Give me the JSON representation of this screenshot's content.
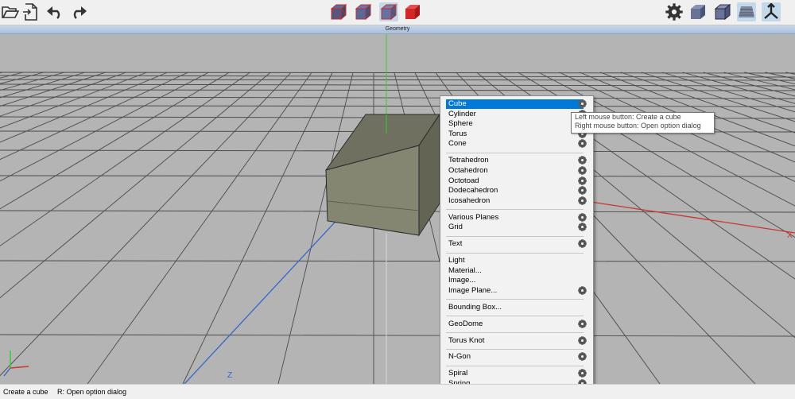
{
  "toolbar": {
    "left": [
      {
        "name": "open-folder-button",
        "icon": "folder-open-icon"
      },
      {
        "name": "import-button",
        "icon": "import-file-icon"
      },
      {
        "name": "undo-button",
        "icon": "undo-icon"
      },
      {
        "name": "redo-button",
        "icon": "redo-icon"
      }
    ],
    "center": [
      {
        "name": "wireframe-cube-button",
        "icon": "cube-wireframe-icon",
        "active": false
      },
      {
        "name": "shaded-wire-cube-button",
        "icon": "cube-shaded-wire-icon",
        "active": false
      },
      {
        "name": "flat-cube-button",
        "icon": "cube-flat-icon",
        "active": true
      },
      {
        "name": "red-cube-button",
        "icon": "cube-red-icon",
        "active": false
      }
    ],
    "right": [
      {
        "name": "settings-button",
        "icon": "gear-icon",
        "active": false
      },
      {
        "name": "solid-cube-view-button",
        "icon": "cube-solid-icon",
        "active": false
      },
      {
        "name": "edge-cube-view-button",
        "icon": "cube-edge-icon",
        "active": false
      },
      {
        "name": "floor-grid-toggle",
        "icon": "floor-grid-icon",
        "active": true
      },
      {
        "name": "axes-toggle",
        "icon": "axes-icon",
        "active": true
      }
    ]
  },
  "panel": {
    "title": "Geometry"
  },
  "viewport": {
    "axis_x_label": "X",
    "axis_z_label": "Z",
    "colors": {
      "background": "#b4b4b4",
      "grid": "#4a4a4a",
      "x_axis": "#cc3333",
      "y_axis": "#33cc33",
      "z_axis": "#3366cc",
      "cube_front": "#858671",
      "cube_top": "#6f705f",
      "cube_side": "#636454"
    }
  },
  "menu": {
    "items": [
      {
        "label": "Cube",
        "gear": true,
        "selected": true
      },
      {
        "label": "Cylinder",
        "gear": true
      },
      {
        "label": "Sphere",
        "gear": true
      },
      {
        "label": "Torus",
        "gear": true
      },
      {
        "label": "Cone",
        "gear": true
      },
      {
        "separator": true
      },
      {
        "label": "Tetrahedron",
        "gear": true
      },
      {
        "label": "Octahedron",
        "gear": true
      },
      {
        "label": "Octotoad",
        "gear": true
      },
      {
        "label": "Dodecahedron",
        "gear": true
      },
      {
        "label": "Icosahedron",
        "gear": true
      },
      {
        "separator": true
      },
      {
        "label": "Various Planes",
        "gear": true
      },
      {
        "label": "Grid",
        "gear": true
      },
      {
        "separator": true
      },
      {
        "label": "Text",
        "gear": true
      },
      {
        "separator": true
      },
      {
        "label": "Light",
        "gear": false
      },
      {
        "label": "Material...",
        "gear": false
      },
      {
        "label": "Image...",
        "gear": false
      },
      {
        "label": "Image Plane...",
        "gear": true
      },
      {
        "separator": true
      },
      {
        "label": "Bounding Box...",
        "gear": false
      },
      {
        "separator": true
      },
      {
        "label": "GeoDome",
        "gear": true
      },
      {
        "separator": true
      },
      {
        "label": "Torus Knot",
        "gear": true
      },
      {
        "separator": true
      },
      {
        "label": "N-Gon",
        "gear": true
      },
      {
        "separator": true
      },
      {
        "label": "Spiral",
        "gear": true
      },
      {
        "label": "Spring",
        "gear": true
      }
    ],
    "selection_color": "#0078d7"
  },
  "tooltip": {
    "line1": "Left mouse button: Create a cube",
    "line2": "Right mouse button: Open option dialog"
  },
  "status": {
    "left": "Create a cube",
    "right": "R: Open option dialog"
  }
}
